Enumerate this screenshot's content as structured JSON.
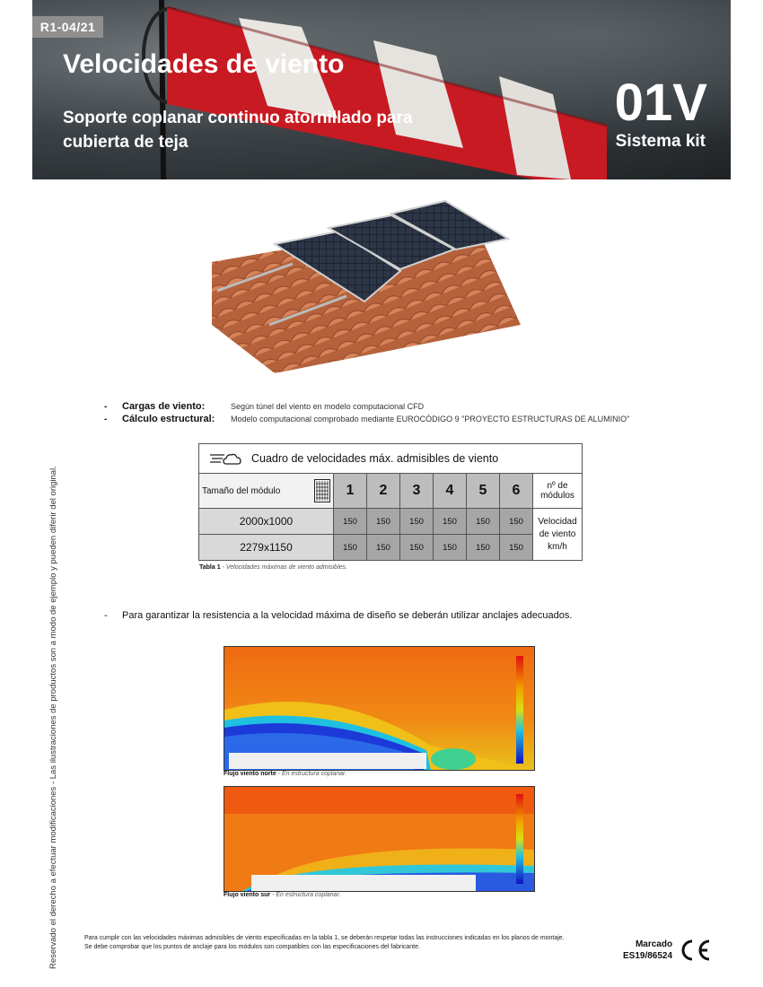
{
  "header": {
    "revision": "R1-04/21",
    "title": "Velocidades de viento",
    "subtitle": "Soporte coplanar continuo atornillado para cubierta de teja",
    "code": "01V",
    "kit": "Sistema kit"
  },
  "side_note": "Reservado el derecho a efectuar modificaciones - Las ilustraciones de productos son a modo de ejemplo y pueden diferir del original.",
  "bullets": [
    {
      "label": "Cargas de viento:",
      "text": "Según túnel del viento en modelo computacional CFD"
    },
    {
      "label": "Cálculo estructural:",
      "text": "Modelo computacional comprobado mediante EUROCÓDIGO 9 \"PROYECTO ESTRUCTURAS DE ALUMINIO\""
    }
  ],
  "table": {
    "title": "Cuadro de velocidades máx. admisibles de viento",
    "size_header": "Tamaño del módulo",
    "module_counts": [
      "1",
      "2",
      "3",
      "4",
      "5",
      "6"
    ],
    "count_header": "nº de módulos",
    "rows": [
      {
        "size": "2000x1000",
        "values": [
          "150",
          "150",
          "150",
          "150",
          "150",
          "150"
        ]
      },
      {
        "size": "2279x1150",
        "values": [
          "150",
          "150",
          "150",
          "150",
          "150",
          "150"
        ]
      }
    ],
    "unit_label": "Velocidad de viento km/h"
  },
  "table_caption": {
    "bold": "Tabla 1",
    "text": " - Velocidades máximas de viento admisibles."
  },
  "note": "Para garantizar la resistencia a la velocidad máxima de diseño se deberán utilizar anclajes adecuados.",
  "cfd_captions": [
    {
      "bold": "Flujo viento norte",
      "text": " - En estructura coplanar."
    },
    {
      "bold": "Flujo viento sur",
      "text": " - En estructura coplanar."
    }
  ],
  "footer": [
    "Para cumplir con las velocidades máximas admisibles de viento especificadas en la tabla 1, se deberán respetar todas las instrucciones indicadas en los planos de montaje.",
    "Se debe comprobar que los puntos de anclaje para los módulos son compatibles con las especificaciones del fabricante."
  ],
  "certification": {
    "line1": "Marcado",
    "line2": "ES19/86524"
  },
  "icons": [
    "wind-cloud-icon",
    "solar-module-icon",
    "ce-mark-icon"
  ]
}
